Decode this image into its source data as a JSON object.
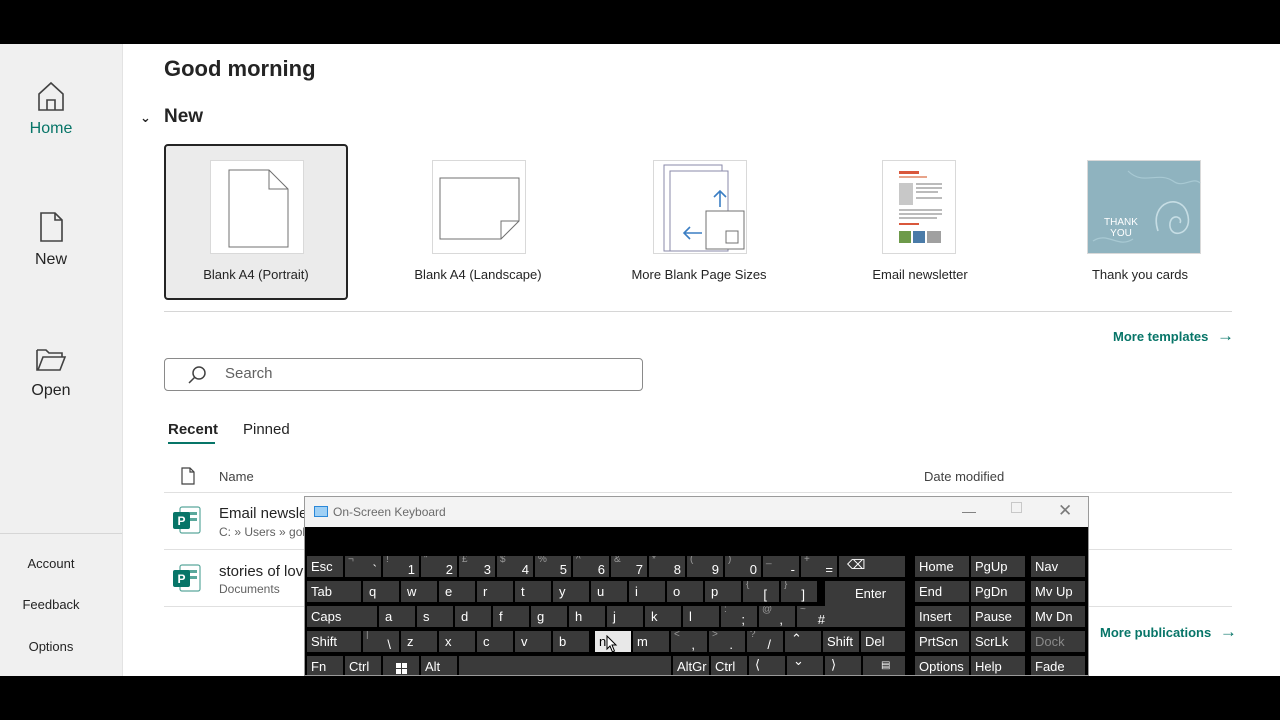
{
  "nav": {
    "home": "Home",
    "new": "New",
    "open": "Open",
    "account": "Account",
    "feedback": "Feedback",
    "options": "Options"
  },
  "greeting": "Good morning",
  "new_section": {
    "title": "New",
    "templates": [
      {
        "label": "Blank A4 (Portrait)"
      },
      {
        "label": "Blank A4 (Landscape)"
      },
      {
        "label": "More Blank Page Sizes"
      },
      {
        "label": "Email newsletter"
      },
      {
        "label": "Thank you cards"
      }
    ],
    "thank_you_text": "THANK YOU",
    "more_templates": "More templates"
  },
  "search": {
    "placeholder": "Search"
  },
  "tabs": {
    "recent": "Recent",
    "pinned": "Pinned"
  },
  "file_list": {
    "col_name": "Name",
    "col_date": "Date modified",
    "files": [
      {
        "name": "Email newsletter",
        "path": "C: » Users » gol"
      },
      {
        "name": "stories of love",
        "path": "Documents"
      }
    ],
    "more_publications": "More publications"
  },
  "osk": {
    "title": "On-Screen Keyboard",
    "keys": {
      "esc": "Esc",
      "tab": "Tab",
      "caps": "Caps",
      "shift": "Shift",
      "fn": "Fn",
      "ctrl": "Ctrl",
      "alt": "Alt",
      "altgr": "AltGr",
      "enter": "Enter",
      "del": "Del",
      "home": "Home",
      "pgup": "PgUp",
      "nav": "Nav",
      "end": "End",
      "pgdn": "PgDn",
      "mvup": "Mv Up",
      "insert": "Insert",
      "pause": "Pause",
      "mvdn": "Mv Dn",
      "prtscn": "PrtScn",
      "scrlk": "ScrLk",
      "dock": "Dock",
      "options": "Options",
      "help": "Help",
      "fade": "Fade",
      "grave": "`",
      "grave_up": "¬",
      "1": "1",
      "1_up": "!",
      "2": "2",
      "2_up": "\"",
      "3": "3",
      "3_up": "£",
      "4": "4",
      "4_up": "$",
      "5": "5",
      "5_up": "%",
      "6": "6",
      "6_up": "^",
      "7": "7",
      "7_up": "&",
      "8": "8",
      "8_up": "*",
      "9": "9",
      "9_up": "(",
      "0": "0",
      "0_up": ")",
      "minus": "-",
      "minus_up": "_",
      "equals": "=",
      "equals_up": "+",
      "q": "q",
      "w": "w",
      "e": "e",
      "r": "r",
      "t": "t",
      "y": "y",
      "u": "u",
      "i": "i",
      "o": "o",
      "p": "p",
      "lbr": "[",
      "lbr_up": "{",
      "rbr": "]",
      "rbr_up": "}",
      "a": "a",
      "s": "s",
      "d": "d",
      "f": "f",
      "g": "g",
      "h": "h",
      "j": "j",
      "k": "k",
      "l": "l",
      "semi": ";",
      "semi_up": ":",
      "apos": ",",
      "apos_up": "@",
      "hash": "#",
      "hash_up": "~",
      "bslash": "\\",
      "bslash_up": "|",
      "z": "z",
      "x": "x",
      "c": "c",
      "v": "v",
      "b": "b",
      "n": "n",
      "m": "m",
      "comma": ",",
      "comma_up": "<",
      "period": ".",
      "period_up": ">",
      "slash": "/",
      "slash_up": "?"
    }
  },
  "colors": {
    "accent": "#077568",
    "key_bg": "#3a3a3a"
  }
}
